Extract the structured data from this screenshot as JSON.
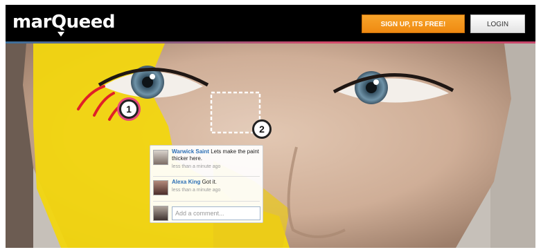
{
  "header": {
    "logo_text_before": "mar",
    "logo_q": "Q",
    "logo_text_after": "ueed",
    "signup_label": "SIGN UP, ITS FREE!",
    "login_label": "LOGIN"
  },
  "markers": [
    {
      "label": "1"
    },
    {
      "label": "2"
    }
  ],
  "comments": [
    {
      "author": "Warwick Saint",
      "text": "Lets make the paint thicker here.",
      "time": "less than a minute ago"
    },
    {
      "author": "Alexa King",
      "text": "Got it.",
      "time": "less than a minute ago"
    }
  ],
  "comment_input": {
    "placeholder": "Add a comment..."
  },
  "colors": {
    "header_bg": "#000000",
    "signup_orange": "#f39a1f",
    "author_link": "#2c6fb5",
    "annotation_red": "#e02027",
    "marker_pink": "#e8497a",
    "paint_yellow": "#f2d60f"
  },
  "icons": {
    "brush_strokes": "annotation-scribble-icon",
    "selection_box": "selection-rectangle-icon"
  }
}
